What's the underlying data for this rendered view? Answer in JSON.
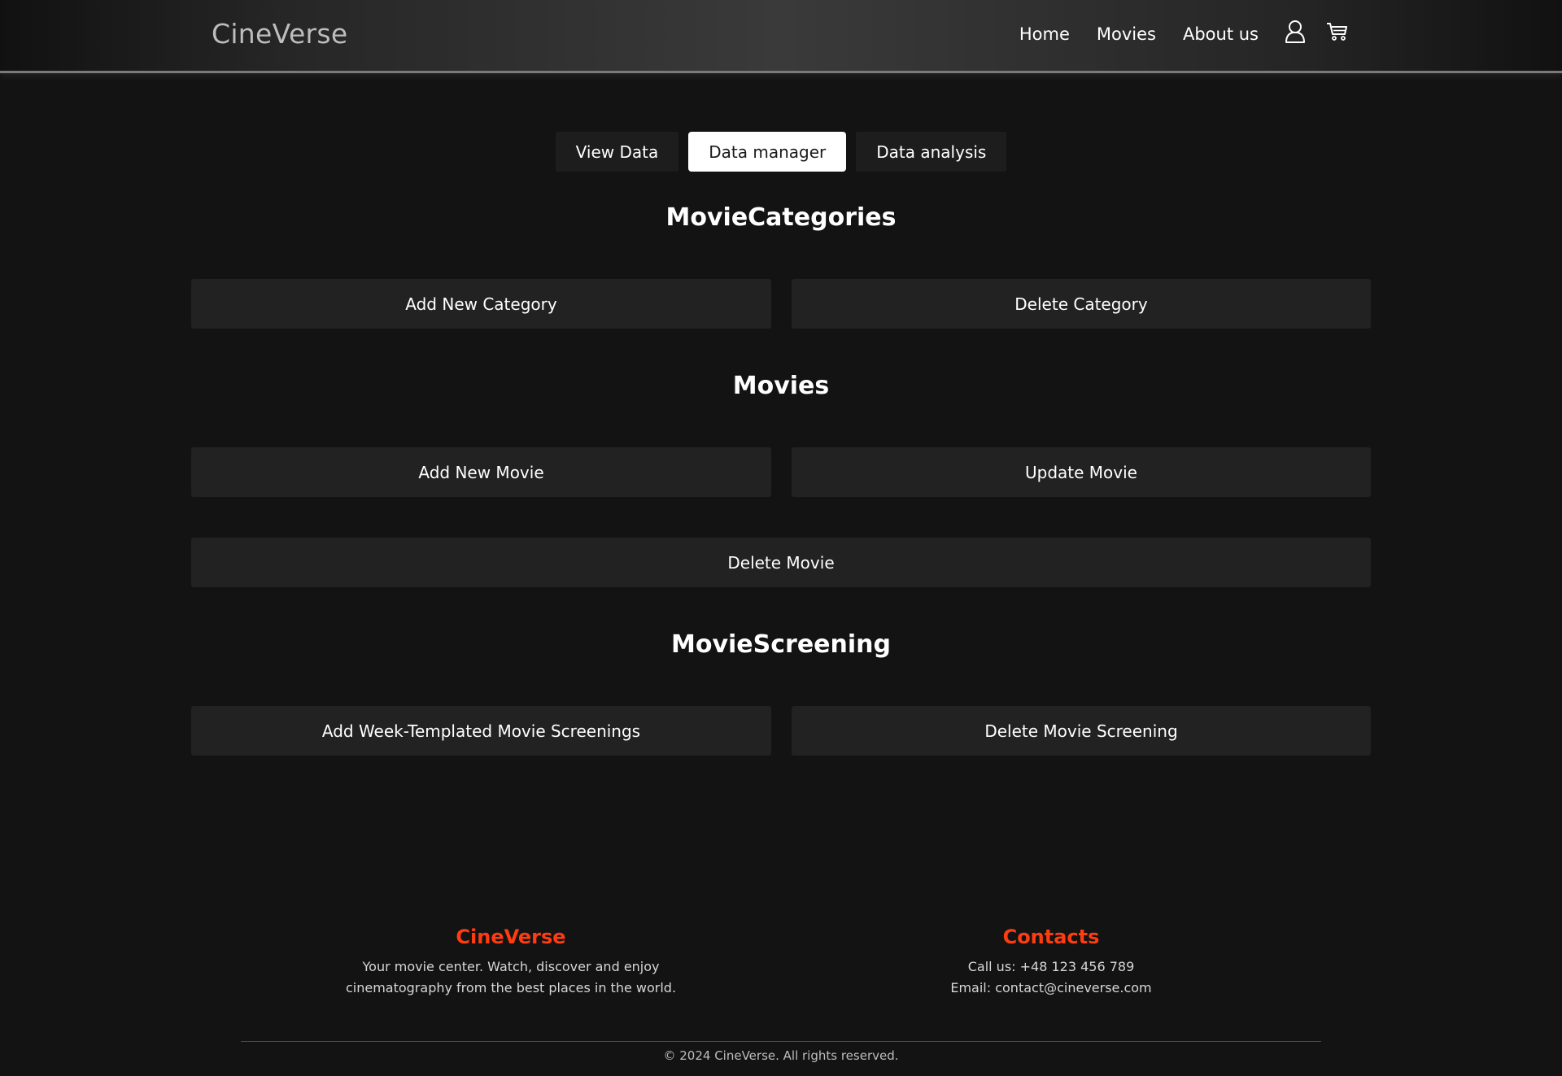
{
  "header": {
    "logo": "CineVerse",
    "nav": [
      "Home",
      "Movies",
      "About us"
    ],
    "icons": [
      "user-icon",
      "cart-icon"
    ]
  },
  "tabs": [
    {
      "label": "View Data",
      "active": false
    },
    {
      "label": "Data manager",
      "active": true
    },
    {
      "label": "Data analysis",
      "active": false
    }
  ],
  "sections": {
    "categories": {
      "title": "MovieCategories",
      "add": "Add New Category",
      "delete": "Delete Category"
    },
    "movies": {
      "title": "Movies",
      "add": "Add New Movie",
      "update": "Update Movie",
      "delete": "Delete Movie"
    },
    "screening": {
      "title": "MovieScreening",
      "add": "Add Week-Templated Movie Screenings",
      "delete": "Delete Movie Screening"
    }
  },
  "footer": {
    "brand_title": "CineVerse",
    "brand_line1": "Your movie center. Watch, discover and enjoy",
    "brand_line2": "cinematography from the best places in the world.",
    "contacts_title": "Contacts",
    "phone": "Call us: +48 123 456 789",
    "email": "Email: contact@cineverse.com",
    "copyright": "© 2024 CineVerse. All rights reserved."
  },
  "colors": {
    "background": "#131313",
    "accent": "#ff3c10",
    "button": "#222222",
    "active_tab": "#ffffff"
  }
}
